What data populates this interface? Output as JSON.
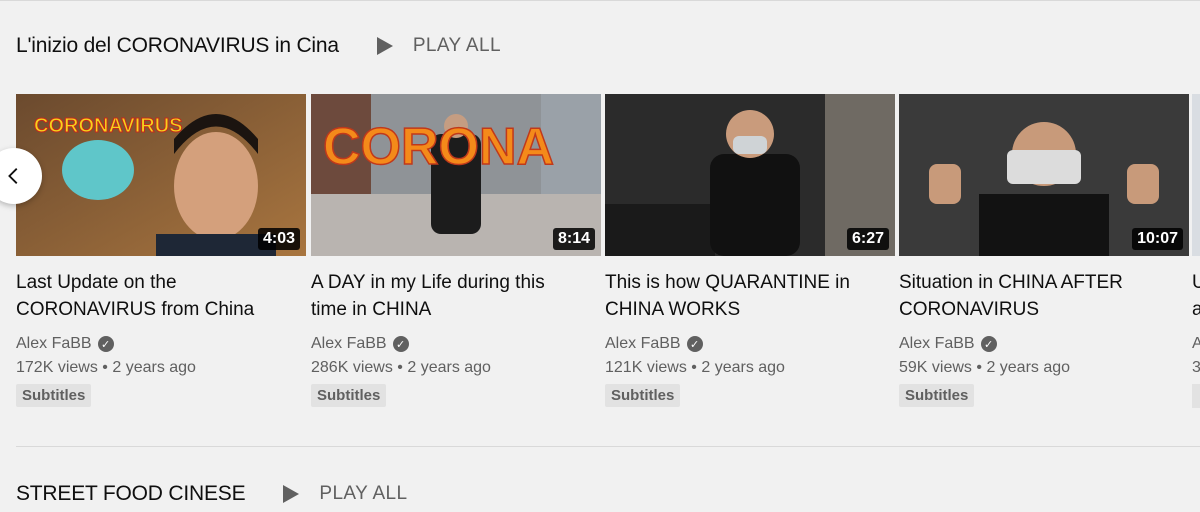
{
  "shelves": [
    {
      "title": "L'inizio del CORONAVIRUS in Cina",
      "play_all": "PLAY ALL"
    },
    {
      "title": "STREET FOOD CINESE",
      "play_all": "PLAY ALL"
    }
  ],
  "videos": [
    {
      "title_line1": "Last Update on the",
      "title_line2": "CORONAVIRUS from China",
      "channel": "Alex FaBB",
      "views": "172K views",
      "age": "2 years ago",
      "badge": "Subtitles",
      "duration": "4:03",
      "thumb_text": "CORONAVIRUS"
    },
    {
      "title_line1": "A DAY in my Life during this",
      "title_line2": "time in CHINA",
      "channel": "Alex FaBB",
      "views": "286K views",
      "age": "2 years ago",
      "badge": "Subtitles",
      "duration": "8:14",
      "thumb_text": "CORONA"
    },
    {
      "title_line1": "This is how QUARANTINE in",
      "title_line2": "CHINA WORKS",
      "channel": "Alex FaBB",
      "views": "121K views",
      "age": "2 years ago",
      "badge": "Subtitles",
      "duration": "6:27",
      "thumb_text": ""
    },
    {
      "title_line1": "Situation in CHINA AFTER",
      "title_line2": "CORONAVIRUS",
      "channel": "Alex FaBB",
      "views": "59K views",
      "age": "2 years ago",
      "badge": "Subtitles",
      "duration": "10:07",
      "thumb_text": ""
    }
  ],
  "peek": {
    "title_line1": "U",
    "title_line2": "a",
    "channel": "A",
    "views": "3"
  },
  "separator": "•",
  "colors": {
    "text": "#0f0f0f",
    "secondary": "#606060",
    "background": "#f1f1f1"
  },
  "icons": {
    "play": "play-icon",
    "verified": "verified-check-icon",
    "prev": "chevron-left-icon"
  }
}
